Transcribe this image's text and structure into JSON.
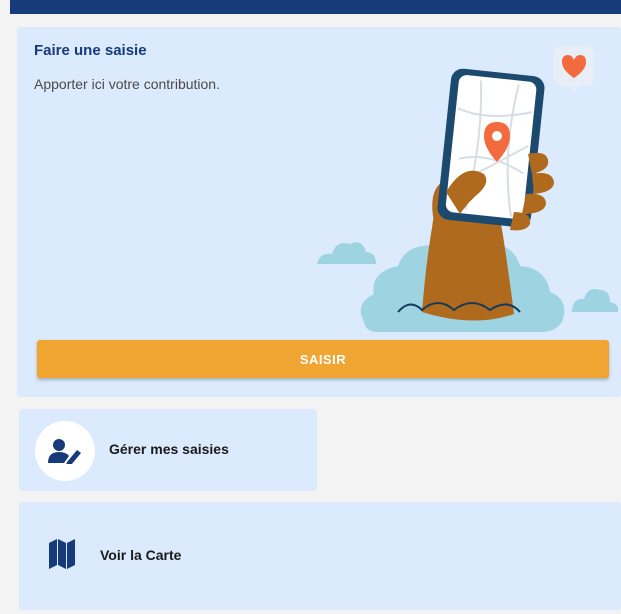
{
  "header": {
    "bar_color": "#163a7a"
  },
  "saisie_card": {
    "title": "Faire une saisie",
    "subtitle": "Apporter ici votre contribution.",
    "illustration": "phone-map-pin-hand-icon",
    "button_label": "SAISIR",
    "button_color": "#f0a431"
  },
  "gerer_card": {
    "label": "Gérer mes saisies",
    "icon": "user-edit-icon"
  },
  "carte_card": {
    "label": "Voir la Carte",
    "icon": "map-icon"
  },
  "colors": {
    "card_bg": "#dceafd",
    "primary": "#163a7a",
    "accent": "#f0a431"
  }
}
